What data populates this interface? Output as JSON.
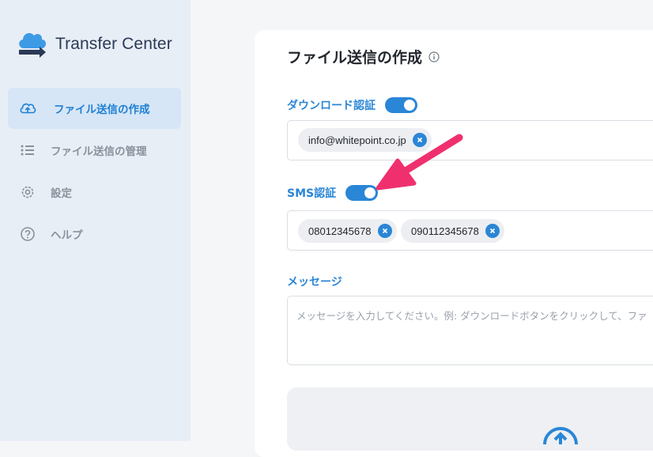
{
  "app": {
    "name_prefix": "Transfer",
    "name_suffix": " Center"
  },
  "sidebar": {
    "items": [
      {
        "label": "ファイル送信の作成",
        "icon": "cloud-upload-icon",
        "active": true
      },
      {
        "label": "ファイル送信の管理",
        "icon": "list-icon",
        "active": false
      },
      {
        "label": "設定",
        "icon": "gear-icon",
        "active": false
      },
      {
        "label": "ヘルプ",
        "icon": "help-circle-icon",
        "active": false
      }
    ]
  },
  "main": {
    "title": "ファイル送信の作成",
    "title_icon": "info-icon",
    "download_auth": {
      "label": "ダウンロード認証",
      "enabled": true,
      "emails": [
        "info@whitepoint.co.jp"
      ]
    },
    "sms_auth": {
      "label": "SMS認証",
      "enabled": true,
      "phones": [
        "08012345678",
        "090112345678"
      ]
    },
    "message": {
      "label": "メッセージ",
      "placeholder": "メッセージを入力してください。例: ダウンロードボタンをクリックして、ファ"
    }
  },
  "colors": {
    "accent": "#2a86d6",
    "sidebar_bg": "#e8eef6",
    "active_bg": "#d6e6f6",
    "annotation_arrow": "#f0306e"
  }
}
